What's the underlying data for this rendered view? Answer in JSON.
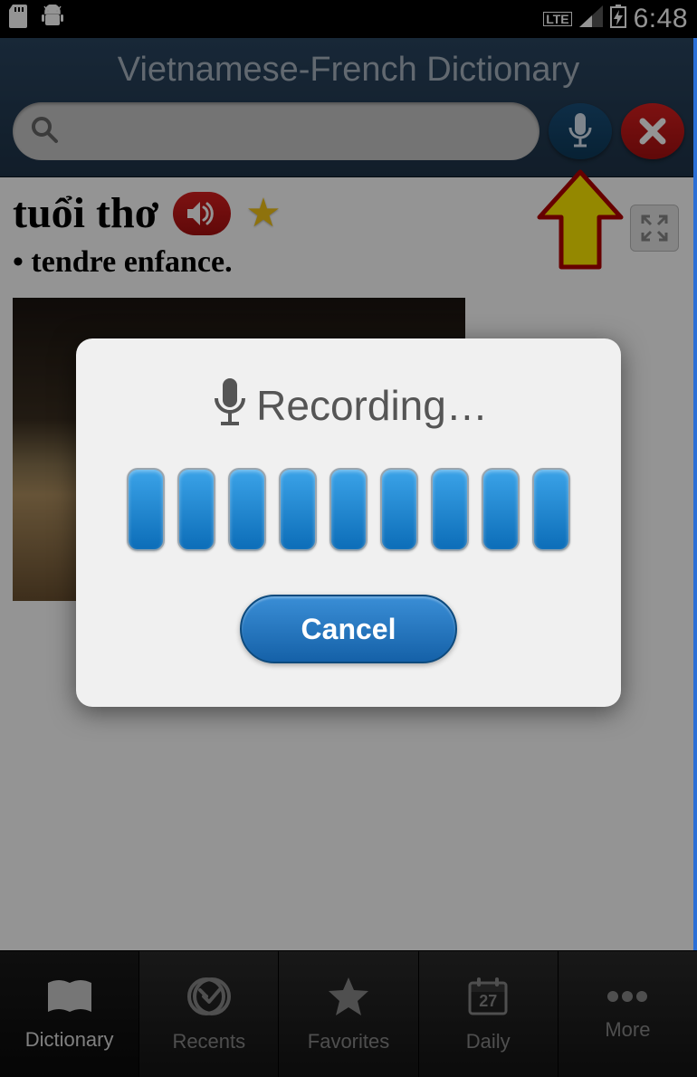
{
  "status_bar": {
    "network_label": "LTE",
    "time": "6:48"
  },
  "header": {
    "title": "Vietnamese-French Dictionary",
    "search_placeholder": ""
  },
  "entry": {
    "word": "tuổi thơ",
    "definition": "• tendre enfance."
  },
  "dialog": {
    "title": "Recording…",
    "cancel_label": "Cancel",
    "bar_count": 9
  },
  "nav": {
    "items": [
      {
        "label": "Dictionary",
        "active": true
      },
      {
        "label": "Recents",
        "active": false
      },
      {
        "label": "Favorites",
        "active": false
      },
      {
        "label": "Daily",
        "active": false
      },
      {
        "label": "More",
        "active": false
      }
    ],
    "daily_date": "27"
  }
}
